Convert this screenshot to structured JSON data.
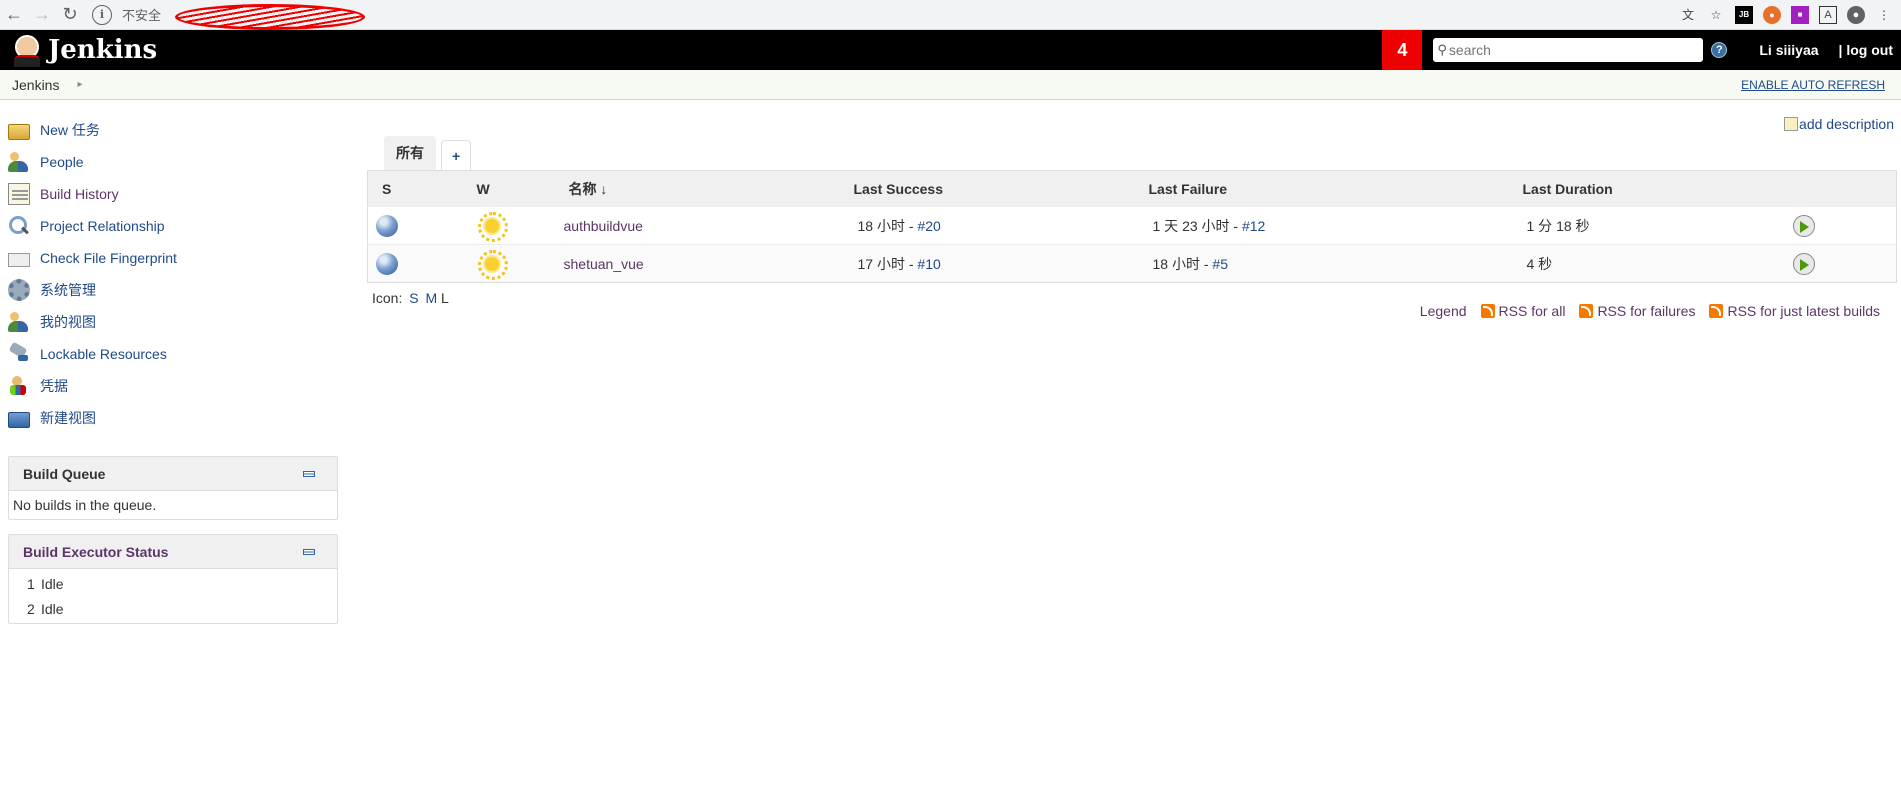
{
  "browser": {
    "insecure_label": "不安全"
  },
  "header": {
    "app_title": "Jenkins",
    "notification_count": "4",
    "search_placeholder": "search",
    "help_label": "?",
    "user_name": "Li siiiyaa",
    "logout_label": "| log out"
  },
  "breadcrumb": {
    "root": "Jenkins",
    "auto_refresh": "ENABLE AUTO REFRESH"
  },
  "sidebar": {
    "tasks": [
      {
        "label": "New 任务",
        "icon": "new-item-icon"
      },
      {
        "label": "People",
        "icon": "people-icon"
      },
      {
        "label": "Build History",
        "icon": "notepad-icon"
      },
      {
        "label": "Project Relationship",
        "icon": "search-icon"
      },
      {
        "label": "Check File Fingerprint",
        "icon": "fingerprint-icon"
      },
      {
        "label": "系统管理",
        "icon": "gear-icon"
      },
      {
        "label": "我的视图",
        "icon": "people-icon"
      },
      {
        "label": "Lockable Resources",
        "icon": "lock-resources-icon"
      },
      {
        "label": "凭据",
        "icon": "credentials-icon"
      },
      {
        "label": "新建视图",
        "icon": "folder-icon"
      }
    ],
    "build_queue": {
      "title": "Build Queue",
      "empty_text": "No builds in the queue."
    },
    "executors": {
      "title": "Build Executor Status",
      "rows": [
        {
          "num": "1",
          "status": "Idle"
        },
        {
          "num": "2",
          "status": "Idle"
        }
      ]
    }
  },
  "main": {
    "add_description": "add description",
    "tabs": [
      {
        "label": "所有"
      },
      {
        "label": "+"
      }
    ],
    "columns": [
      "S",
      "W",
      "名称 ↓",
      "Last Success",
      "Last Failure",
      "Last Duration"
    ],
    "jobs": [
      {
        "name": "authbuildvue",
        "last_success_text": "18 小时 - ",
        "last_success_build": "#20",
        "last_failure_text": "1 天 23 小时 - ",
        "last_failure_build": "#12",
        "last_duration": "1 分 18 秒"
      },
      {
        "name": "shetuan_vue",
        "last_success_text": "17 小时 - ",
        "last_success_build": "#10",
        "last_failure_text": "18 小时 - ",
        "last_failure_build": "#5",
        "last_duration": "4 秒"
      }
    ],
    "icon_size": {
      "label": "Icon:",
      "sizes": [
        "S",
        "M",
        "L"
      ]
    },
    "legend": "Legend",
    "rss": [
      "RSS for all",
      "RSS for failures",
      "RSS for just latest builds"
    ]
  }
}
